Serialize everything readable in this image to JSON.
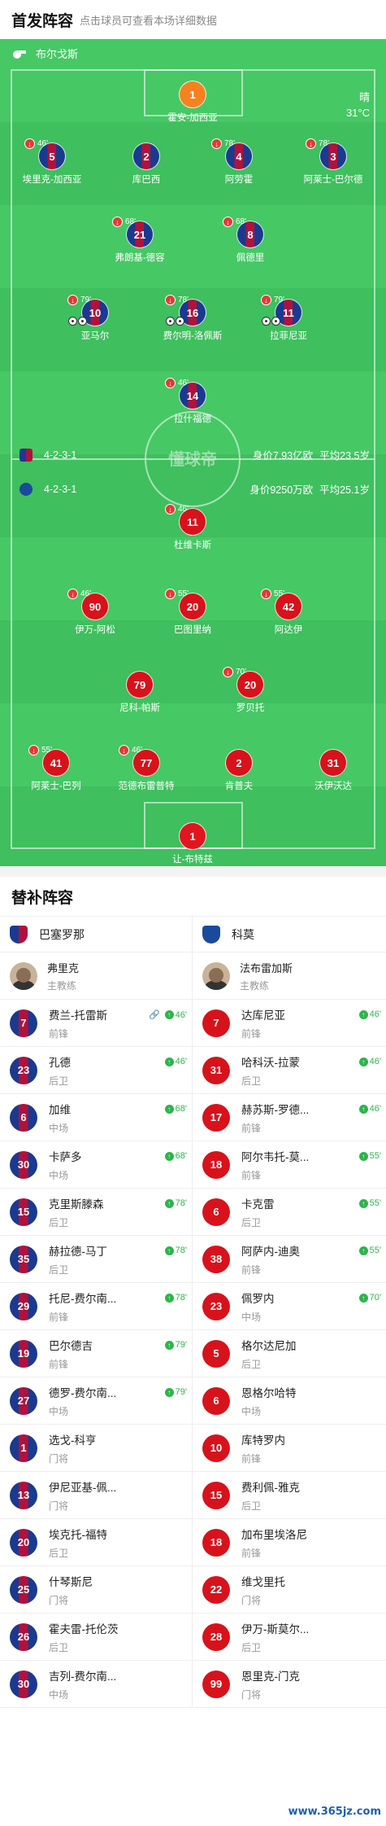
{
  "header": {
    "title": "首发阵容",
    "subtitle": "点击球员可查看本场详细数据"
  },
  "venue": "布尔戈斯",
  "weather": {
    "condition": "晴",
    "temp": "31°C"
  },
  "watermark_center": "懂球帝",
  "home": {
    "formation": "4-2-3-1",
    "value": "身价7.93亿欧",
    "age": "平均23.5岁"
  },
  "away": {
    "formation": "4-2-3-1",
    "value": "身价9250万欧",
    "age": "平均25.1岁"
  },
  "lineup_home": [
    {
      "num": "1",
      "name": "霍安-加西亚",
      "gk": true
    },
    {
      "num": "5",
      "name": "埃里克-加西亚",
      "sub": "46'"
    },
    {
      "num": "2",
      "name": "库巴西"
    },
    {
      "num": "4",
      "name": "阿劳霍",
      "sub": "78'"
    },
    {
      "num": "3",
      "name": "阿莱士-巴尔德",
      "sub": "78'"
    },
    {
      "num": "21",
      "name": "弗朗基-德容",
      "sub": "68'"
    },
    {
      "num": "8",
      "name": "佩德里",
      "sub": "68'"
    },
    {
      "num": "10",
      "name": "亚马尔",
      "sub": "79'",
      "events": 2
    },
    {
      "num": "16",
      "name": "费尔明-洛佩斯",
      "sub": "78'",
      "events": 2
    },
    {
      "num": "11",
      "name": "拉菲尼亚",
      "sub": "79'",
      "events": 2
    },
    {
      "num": "14",
      "name": "拉什福德",
      "sub": "46'"
    }
  ],
  "lineup_away": [
    {
      "num": "11",
      "name": "杜维卡斯",
      "sub": "46'"
    },
    {
      "num": "90",
      "name": "伊万-阿松",
      "sub": "46'"
    },
    {
      "num": "20",
      "name": "巴图里纳",
      "sub": "55'"
    },
    {
      "num": "42",
      "name": "阿达伊",
      "sub": "55'"
    },
    {
      "num": "79",
      "name": "尼科-帕斯"
    },
    {
      "num": "20",
      "name": "罗贝托",
      "sub": "70'"
    },
    {
      "num": "41",
      "name": "阿莱士-巴列",
      "sub": "55'"
    },
    {
      "num": "77",
      "name": "范德布雷普特",
      "sub": "46'"
    },
    {
      "num": "2",
      "name": "肯普夫"
    },
    {
      "num": "31",
      "name": "沃伊沃达"
    },
    {
      "num": "1",
      "name": "让-布特兹",
      "gk": true
    }
  ],
  "subs_title": "替补阵容",
  "team_home": "巴塞罗那",
  "team_away": "科莫",
  "coach_home": {
    "name": "弗里克",
    "role": "主教练"
  },
  "coach_away": {
    "name": "法布雷加斯",
    "role": "主教练"
  },
  "subs_home": [
    {
      "num": "7",
      "name": "费兰-托雷斯",
      "pos": "前锋",
      "on": "46'",
      "link": true
    },
    {
      "num": "23",
      "name": "孔德",
      "pos": "后卫",
      "on": "46'"
    },
    {
      "num": "6",
      "name": "加维",
      "pos": "中场",
      "on": "68'"
    },
    {
      "num": "30",
      "name": "卡萨多",
      "pos": "中场",
      "on": "68'"
    },
    {
      "num": "15",
      "name": "克里斯滕森",
      "pos": "后卫",
      "on": "78'"
    },
    {
      "num": "35",
      "name": "赫拉德-马丁",
      "pos": "后卫",
      "on": "78'"
    },
    {
      "num": "29",
      "name": "托尼-费尔南...",
      "pos": "前锋",
      "on": "78'"
    },
    {
      "num": "19",
      "name": "巴尔德吉",
      "pos": "前锋",
      "on": "79'"
    },
    {
      "num": "27",
      "name": "德罗-费尔南...",
      "pos": "中场",
      "on": "79'"
    },
    {
      "num": "1",
      "name": "选戈-科亨",
      "pos": "门将"
    },
    {
      "num": "13",
      "name": "伊尼亚基-佩...",
      "pos": "门将"
    },
    {
      "num": "20",
      "name": "埃克托-福特",
      "pos": "后卫"
    },
    {
      "num": "25",
      "name": "什琴斯尼",
      "pos": "门将"
    },
    {
      "num": "26",
      "name": "霍夫雷-托伦茨",
      "pos": "后卫"
    },
    {
      "num": "30",
      "name": "吉列-费尔南...",
      "pos": "中场"
    }
  ],
  "subs_away": [
    {
      "num": "7",
      "name": "达库尼亚",
      "pos": "前锋",
      "on": "46'"
    },
    {
      "num": "31",
      "name": "哈科沃-拉蒙",
      "pos": "后卫",
      "on": "46'"
    },
    {
      "num": "17",
      "name": "赫苏斯-罗德...",
      "pos": "前锋",
      "on": "46'"
    },
    {
      "num": "18",
      "name": "阿尔韦托-莫...",
      "pos": "前锋",
      "on": "55'"
    },
    {
      "num": "6",
      "name": "卡克雷",
      "pos": "后卫",
      "on": "55'"
    },
    {
      "num": "38",
      "name": "阿萨内-迪奥",
      "pos": "前锋",
      "on": "55'"
    },
    {
      "num": "23",
      "name": "佩罗内",
      "pos": "中场",
      "on": "70'"
    },
    {
      "num": "5",
      "name": "格尔达尼加",
      "pos": "后卫"
    },
    {
      "num": "6",
      "name": "恩格尔哈特",
      "pos": "中场"
    },
    {
      "num": "10",
      "name": "库特罗内",
      "pos": "前锋"
    },
    {
      "num": "15",
      "name": "费利佩-雅克",
      "pos": "后卫"
    },
    {
      "num": "18",
      "name": "加布里埃洛尼",
      "pos": "前锋"
    },
    {
      "num": "22",
      "name": "维戈里托",
      "pos": "门将"
    },
    {
      "num": "28",
      "name": "伊万-斯莫尔...",
      "pos": "后卫"
    },
    {
      "num": "99",
      "name": "恩里克-门克",
      "pos": "门将"
    }
  ],
  "site": "www.365jz.com"
}
